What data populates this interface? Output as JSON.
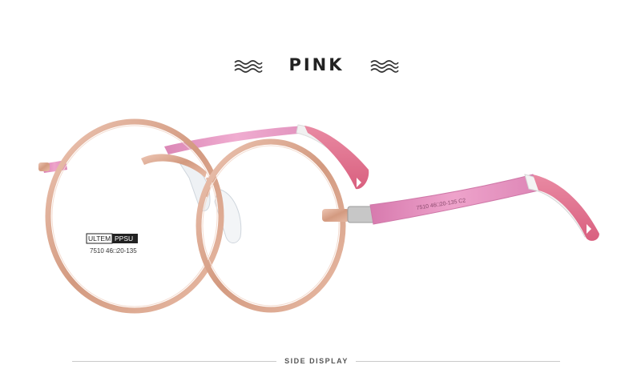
{
  "heading": {
    "title": "PINK"
  },
  "lens_sticker": {
    "brand_a": "ULTEM",
    "brand_b": "PPSU",
    "model_line": "7510 46□20-135"
  },
  "temple_print": "7510 46□20-135 C2",
  "footer": {
    "label": "SIDE DISPLAY"
  },
  "colors": {
    "frame_rose_gold": "#d9a78f",
    "temple_pink": "#e58bbd",
    "tip_pink": "#e06b8b",
    "title": "#222222"
  }
}
